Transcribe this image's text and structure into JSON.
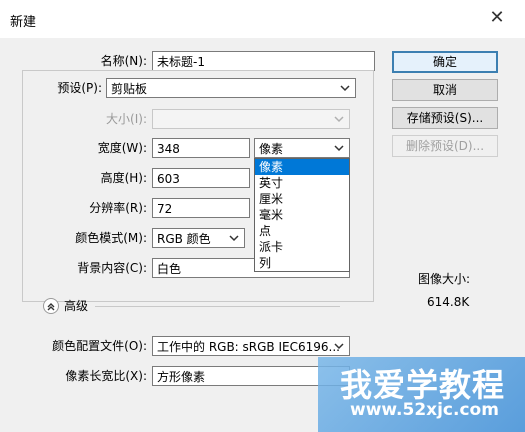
{
  "window": {
    "title": "新建",
    "close_glyph": "✕"
  },
  "form": {
    "name": {
      "label": "名称(N):",
      "value": "未标题-1"
    },
    "preset": {
      "label": "预设(P):",
      "value": "剪贴板"
    },
    "size": {
      "label": "大小(I):",
      "value": ""
    },
    "width": {
      "label": "宽度(W):",
      "value": "348",
      "unit": "像素"
    },
    "height": {
      "label": "高度(H):",
      "value": "603"
    },
    "resolution": {
      "label": "分辨率(R):",
      "value": "72"
    },
    "color_mode": {
      "label": "颜色模式(M):",
      "value": "RGB 颜色"
    },
    "background": {
      "label": "背景内容(C):",
      "value": "白色"
    },
    "advanced": {
      "label": "高级"
    },
    "color_profile": {
      "label": "颜色配置文件(O):",
      "value": "工作中的 RGB: sRGB IEC6196..."
    },
    "pixel_aspect": {
      "label": "像素长宽比(X):",
      "value": "方形像素"
    }
  },
  "unit_dropdown": {
    "options": [
      "像素",
      "英寸",
      "厘米",
      "毫米",
      "点",
      "派卡",
      "列"
    ],
    "selected": "像素"
  },
  "buttons": {
    "ok": "确定",
    "cancel": "取消",
    "save_preset": "存储预设(S)...",
    "delete_preset": "删除预设(D)..."
  },
  "image_size": {
    "label": "图像大小:",
    "value": "614.8K"
  },
  "watermark": {
    "line1": "我爱学教程",
    "line2": "www.52xjc.com"
  }
}
